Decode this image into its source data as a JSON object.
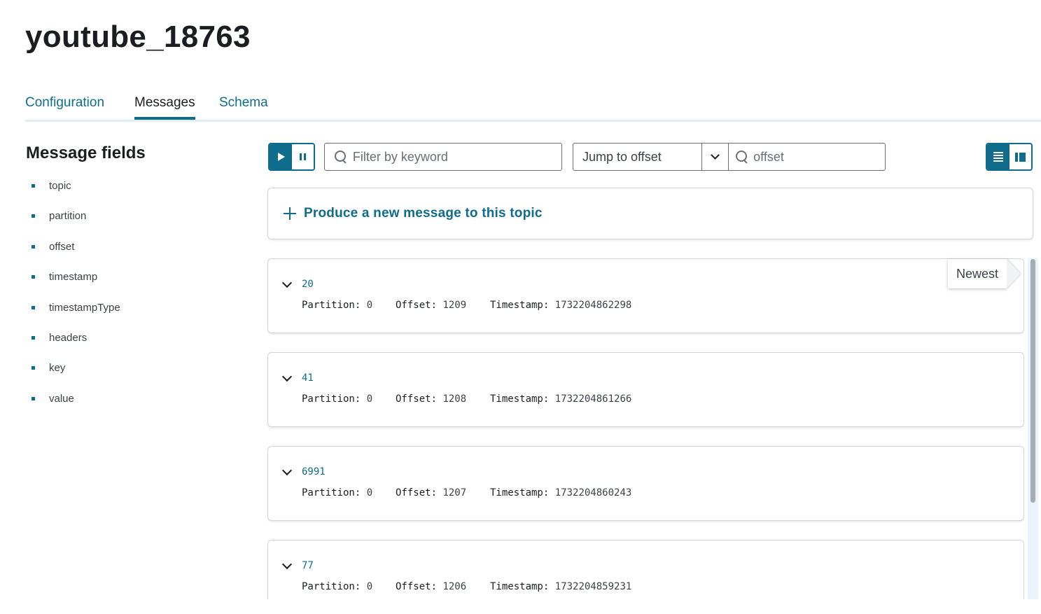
{
  "topic_title": "youtube_18763",
  "tabs": {
    "configuration": "Configuration",
    "messages": "Messages",
    "schema": "Schema"
  },
  "fields": {
    "title": "Message fields",
    "items": [
      "topic",
      "partition",
      "offset",
      "timestamp",
      "timestampType",
      "headers",
      "key",
      "value"
    ]
  },
  "toolbar": {
    "filter_placeholder": "Filter by keyword",
    "jump_select": "Jump to offset",
    "offset_placeholder": "offset",
    "accent_color": "#0f6c8c"
  },
  "produce": {
    "label": "Produce a new message to this topic"
  },
  "newest_label": "Newest",
  "meta_labels": {
    "partition": "Partition:",
    "offset": "Offset:",
    "timestamp": "Timestamp:"
  },
  "messages": [
    {
      "key": "20",
      "partition": "0",
      "offset": "1209",
      "timestamp": "1732204862298"
    },
    {
      "key": "41",
      "partition": "0",
      "offset": "1208",
      "timestamp": "1732204861266"
    },
    {
      "key": "6991",
      "partition": "0",
      "offset": "1207",
      "timestamp": "1732204860243"
    },
    {
      "key": "77",
      "partition": "0",
      "offset": "1206",
      "timestamp": "1732204859231"
    }
  ]
}
